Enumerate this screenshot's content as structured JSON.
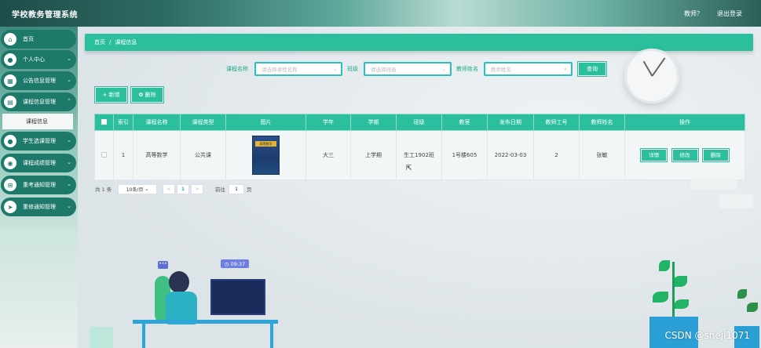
{
  "header": {
    "title": "学校教务管理系统",
    "user": "教师？",
    "logout": "退出登录"
  },
  "sidebar": {
    "items": [
      {
        "label": "首页",
        "icon": "home-icon",
        "glyph": "⌂"
      },
      {
        "label": "个人中心",
        "icon": "user-icon",
        "glyph": "●"
      },
      {
        "label": "公告信息管理",
        "icon": "grid-icon",
        "glyph": "▦"
      },
      {
        "label": "课程信息管理",
        "icon": "table-icon",
        "glyph": "▤"
      },
      {
        "label": "学生选课管理",
        "icon": "user-icon",
        "glyph": "●"
      },
      {
        "label": "课程成绩管理",
        "icon": "gear-icon",
        "glyph": "◉"
      },
      {
        "label": "重考通知管理",
        "icon": "apps-icon",
        "glyph": "⊞"
      },
      {
        "label": "重修通知管理",
        "icon": "send-icon",
        "glyph": "➤"
      }
    ],
    "active_sub": "课程信息"
  },
  "breadcrumb": {
    "home": "首页",
    "separator": "/",
    "current": "课程信息"
  },
  "search": {
    "course_label": "课程名称",
    "course_placeholder": "请选择课程名称",
    "class_label": "班级",
    "class_placeholder": "请选择班级",
    "teacher_label": "教师姓名",
    "teacher_placeholder": "教师姓名",
    "query_button": "查询"
  },
  "toolbar": {
    "add": "+ 新增",
    "delete": "✿ 删除"
  },
  "table": {
    "headers": [
      "索引",
      "课程名称",
      "课程类型",
      "图片",
      "学年",
      "学期",
      "班级",
      "教室",
      "发布日期",
      "教师工号",
      "教师姓名",
      "操作"
    ],
    "rows": [
      {
        "index": "1",
        "course": "高等数学",
        "type": "公共课",
        "book_title": "高等数学",
        "year": "大三",
        "term": "上学期",
        "class": "生工1902班",
        "room": "1号楼605",
        "date": "2022-03-03",
        "teacher_id": "2",
        "teacher_name": "张敏"
      }
    ],
    "actions": [
      "详情",
      "修改",
      "删除"
    ]
  },
  "pagination": {
    "total": "共 1 条",
    "page_size": "10条/页",
    "prev": "<",
    "page": "1",
    "next": ">",
    "goto_label": "前往",
    "goto_value": "1",
    "page_unit": "页"
  },
  "decor": {
    "clock_time": "09:37",
    "watermark": "CSDN @sheji1071"
  }
}
